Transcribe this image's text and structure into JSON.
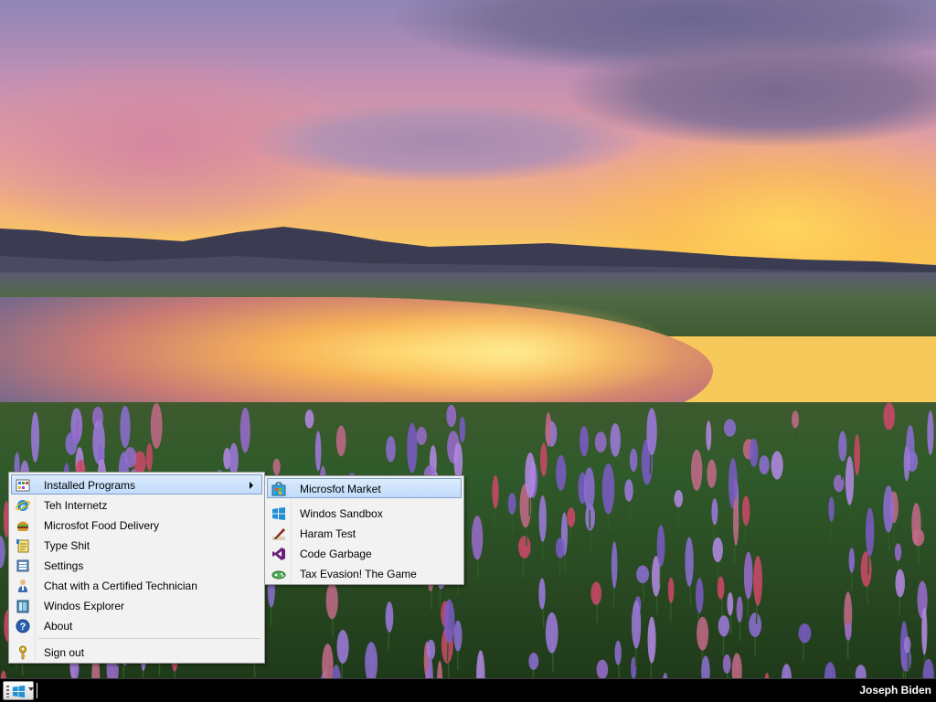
{
  "start_menu": {
    "items": [
      {
        "label": "Installed Programs",
        "icon": "installed-programs-icon",
        "has_submenu": true,
        "selected": true
      },
      {
        "label": "Teh Internetz",
        "icon": "internet-explorer-icon"
      },
      {
        "label": "Microsfot Food Delivery",
        "icon": "burger-icon"
      },
      {
        "label": "Type Shit",
        "icon": "notepad-icon"
      },
      {
        "label": "Settings",
        "icon": "settings-icon"
      },
      {
        "label": "Chat with a Certified Technician",
        "icon": "technician-icon"
      },
      {
        "label": "Windos Explorer",
        "icon": "explorer-icon"
      },
      {
        "label": "About",
        "icon": "help-icon"
      }
    ],
    "sign_out": {
      "label": "Sign out",
      "icon": "key-icon"
    }
  },
  "submenu": {
    "items": [
      {
        "label": "Microsfot Market",
        "icon": "market-icon",
        "selected": true
      },
      {
        "label": "Windos Sandbox",
        "icon": "windows-logo-icon"
      },
      {
        "label": "Haram Test",
        "icon": "pen-icon"
      },
      {
        "label": "Code Garbage",
        "icon": "visual-studio-icon"
      },
      {
        "label": "Tax Evasion! The Game",
        "icon": "game-icon"
      }
    ]
  },
  "taskbar": {
    "user": "Joseph Biden",
    "start_icon": "windows-logo-icon"
  },
  "colors": {
    "selection_fill": "#c1dcfc",
    "selection_border": "#7da2ce",
    "taskbar": "#000000",
    "windows_blue": "#1e90d6"
  }
}
